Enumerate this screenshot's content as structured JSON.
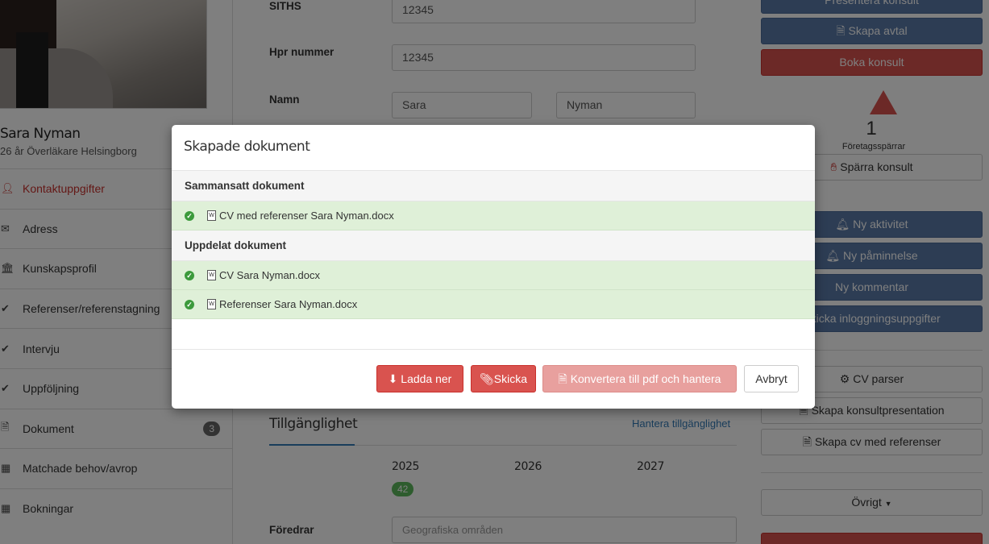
{
  "sidebar": {
    "name": "Sara Nyman",
    "subtitle": "26 år Överläkare Helsingborg",
    "items": [
      {
        "label": "Kontaktuppgifter",
        "icon": "user-icon"
      },
      {
        "label": "Adress",
        "icon": "envelope-icon"
      },
      {
        "label": "Kunskapsprofil",
        "icon": "bank-icon"
      },
      {
        "label": "Referenser/referenstagning",
        "icon": "check-circle-icon"
      },
      {
        "label": "Intervju",
        "icon": "check-circle-icon"
      },
      {
        "label": "Uppföljning",
        "icon": "check-circle-icon"
      },
      {
        "label": "Dokument",
        "icon": "file-icon",
        "count": "3"
      },
      {
        "label": "Matchade behov/avrop",
        "icon": "calendar-icon"
      },
      {
        "label": "Bokningar",
        "icon": "calendar-icon"
      }
    ]
  },
  "form": {
    "siths_label": "SITHS",
    "siths_value": "12345",
    "hpr_label": "Hpr nummer",
    "hpr_value": "12345",
    "name_label": "Namn",
    "first_name": "Sara",
    "last_name": "Nyman",
    "availability_title": "Tillgänglighet",
    "availability_link": "Hantera tillgänglighet",
    "years": [
      "2025",
      "2026",
      "2027"
    ],
    "year_badge": "42",
    "prefers_label": "Föredrar",
    "prefers_placeholder": "Geografiska områden"
  },
  "actions": {
    "present": "Presentera konsult",
    "create_agreement": "Skapa avtal",
    "book": "Boka konsult",
    "block_count": "1",
    "block_label": "Företagsspärrar",
    "block_button": "Spärra konsult",
    "new_activity": "Ny aktivitet",
    "new_reminder": "Ny påminnelse",
    "new_comment": "Ny kommentar",
    "send_login": "Skicka inloggningsuppgifter",
    "cv_parser": "CV parser",
    "create_presentation": "Skapa konsultpresentation",
    "create_cv_refs": "Skapa cv med referenser",
    "other": "Övrigt"
  },
  "modal": {
    "title": "Skapade dokument",
    "group1": "Sammansatt dokument",
    "group1_files": [
      "CV med referenser Sara Nyman.docx"
    ],
    "group2": "Uppdelat dokument",
    "group2_files": [
      "CV Sara Nyman.docx",
      "Referenser Sara Nyman.docx"
    ],
    "download": "Ladda ner",
    "send": "Skicka",
    "convert": "Konvertera till pdf och hantera",
    "cancel": "Avbryt"
  },
  "colors": {
    "primary_blue": "#5a7aa8",
    "danger_red": "#d9534f",
    "success_bg": "#dff0d8",
    "link_blue": "#337ab7"
  }
}
